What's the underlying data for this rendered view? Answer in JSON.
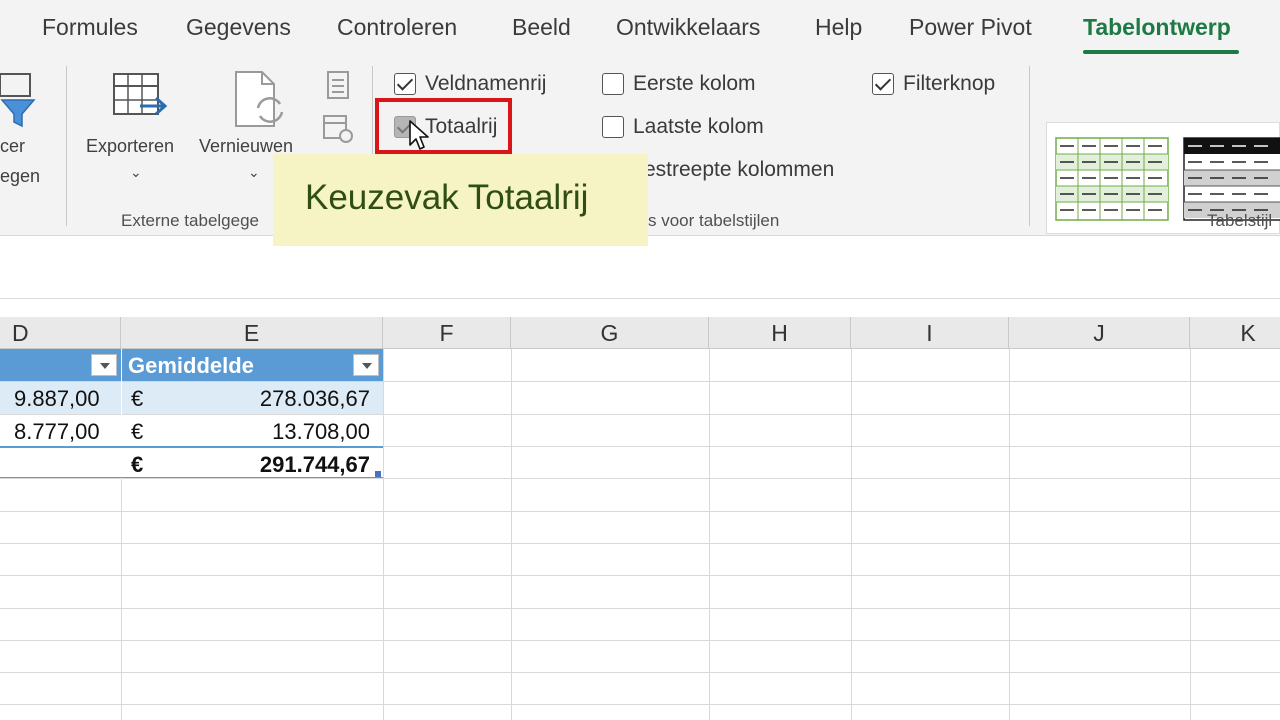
{
  "tabs": [
    {
      "label": "Formules"
    },
    {
      "label": "Gegevens"
    },
    {
      "label": "Controleren"
    },
    {
      "label": "Beeld"
    },
    {
      "label": "Ontwikkelaars"
    },
    {
      "label": "Help"
    },
    {
      "label": "Power Pivot"
    },
    {
      "label": "Tabelontwerp",
      "active": true
    }
  ],
  "ribbon": {
    "left_partial": {
      "line1": "cer",
      "line2": "egen"
    },
    "export_label": "Exporteren",
    "refresh_label": "Vernieuwen",
    "external_group_label": "Externe tabelgege",
    "checkboxes": {
      "header_row": {
        "label": "Veldnamenrij",
        "checked": true
      },
      "total_row": {
        "label": "Totaalrij",
        "checked": true
      },
      "banded_cols_partial": {
        "label": "estreepte kolommen"
      },
      "first_col": {
        "label": "Eerste kolom",
        "checked": false
      },
      "last_col": {
        "label": "Laatste kolom",
        "checked": false
      },
      "filter_button": {
        "label": "Filterknop",
        "checked": true
      }
    },
    "style_options_group_label": "s voor tabelstijlen",
    "table_styles_group_label": "Tabelstijl"
  },
  "tooltip": {
    "text": "Keuzevak Totaalrij"
  },
  "grid": {
    "columns": [
      "D",
      "E",
      "F",
      "G",
      "H",
      "I",
      "J",
      "K"
    ],
    "table": {
      "header_e": "Gemiddelde",
      "rows": [
        {
          "d": "9.887,00",
          "e_cur": "€",
          "e_val": "278.036,67"
        },
        {
          "d": "8.777,00",
          "e_cur": "€",
          "e_val": "13.708,00"
        }
      ],
      "total": {
        "e_cur": "€",
        "e_val": "291.744,67"
      }
    }
  },
  "colors": {
    "accent": "#1d7a45",
    "table_header": "#5b9bd5",
    "table_band": "#ddebf7",
    "highlight": "#d9151a",
    "tooltip_bg": "#f6f3c4"
  }
}
